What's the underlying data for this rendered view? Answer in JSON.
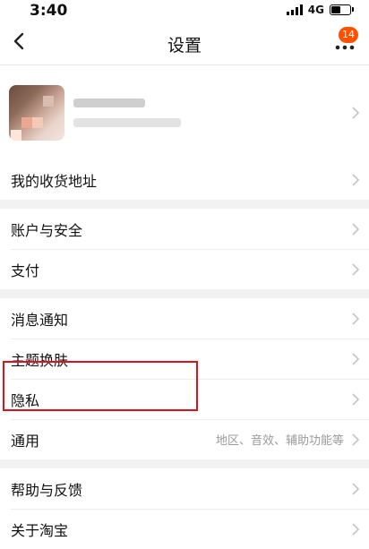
{
  "status_bar": {
    "time": "3:40",
    "network": "4G"
  },
  "nav": {
    "title": "设置",
    "badge_count": "14"
  },
  "groups": {
    "account": {
      "address_label": "我的收货地址"
    },
    "security": {
      "account_security": "账户与安全",
      "payment": "支付"
    },
    "prefs": {
      "notifications": "消息通知",
      "theme": "主题换肤",
      "privacy": "隐私",
      "general": "通用",
      "general_hint": "地区、音效、辅助功能等"
    },
    "help": {
      "feedback": "帮助与反馈",
      "about": "关于淘宝"
    }
  },
  "colors": {
    "badge": "#ff5000",
    "highlight": "#e2101a"
  },
  "icons": [
    "back-arrow-icon",
    "more-dots-icon",
    "chevron-right-icon",
    "signal-icon",
    "battery-icon"
  ]
}
